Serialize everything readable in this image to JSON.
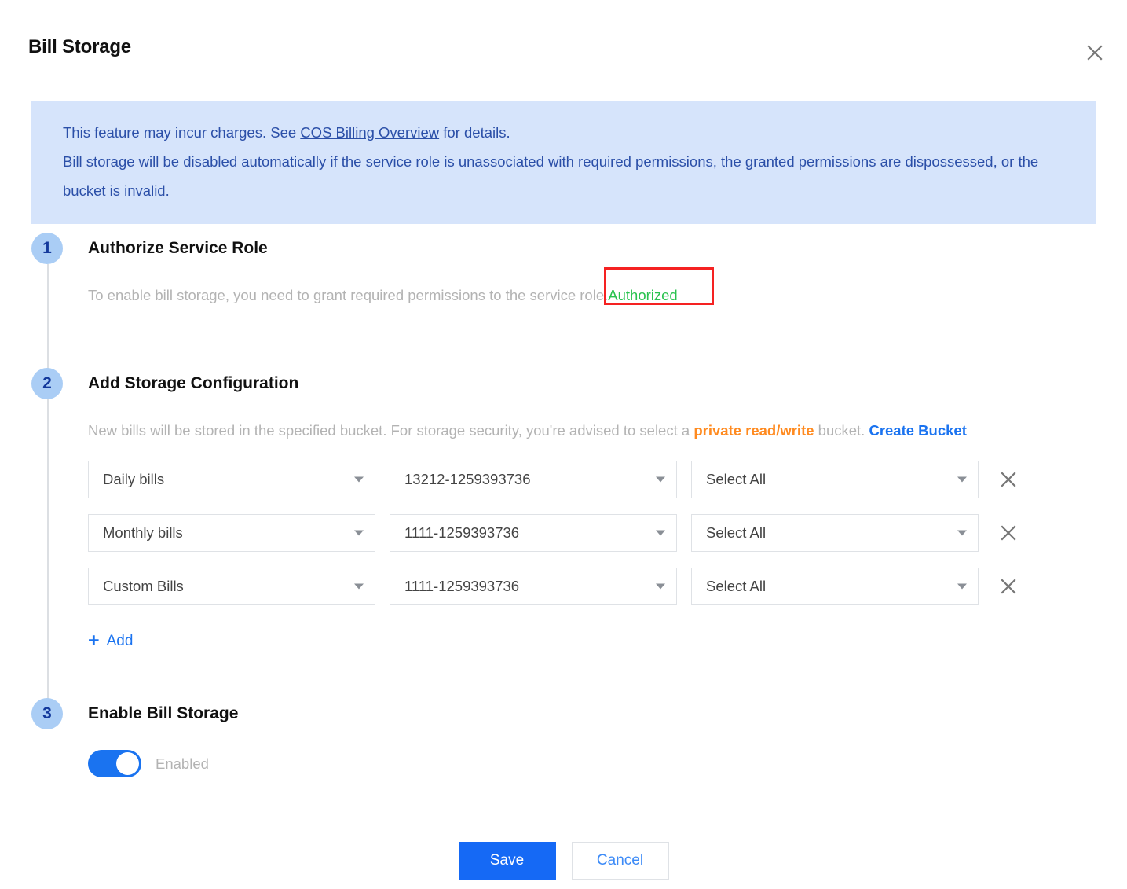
{
  "dialog": {
    "title": "Bill Storage",
    "close_icon": "close-icon"
  },
  "banner": {
    "line1_before": "This feature may incur charges. See ",
    "line1_link": "COS Billing Overview",
    "line1_after": " for details.",
    "line2": "Bill storage will be disabled automatically if the service role is unassociated with required permissions, the granted permissions are dispossessed, or the bucket is invalid.",
    "background_color": "#d6e4fb",
    "text_color": "#2b4fa8"
  },
  "steps": [
    {
      "number": "1",
      "title": "Authorize Service Role",
      "description": "To enable bill storage, you need to grant required permissions to the service role.",
      "status_label": "Authorized",
      "status_color": "#29c24e",
      "annotation_color": "#f52222"
    },
    {
      "number": "2",
      "title": "Add Storage Configuration",
      "desc_part1": "New bills will be stored in the specified bucket. For storage security, you're advised to select a ",
      "desc_highlight": "private read/write",
      "desc_part2": " bucket. ",
      "desc_link": "Create Bucket",
      "highlight_color": "#ff8a1f",
      "link_color": "#1a73f0",
      "add_label": "Add",
      "add_icon": "plus-icon",
      "rows": [
        {
          "bill_type": "Daily bills",
          "bucket": "13212-1259393736",
          "scope": "Select All",
          "delete_icon": "close-icon"
        },
        {
          "bill_type": "Monthly bills",
          "bucket": "1111-1259393736",
          "scope": "Select All",
          "delete_icon": "close-icon"
        },
        {
          "bill_type": "Custom Bills",
          "bucket": "1111-1259393736",
          "scope": "Select All",
          "delete_icon": "close-icon"
        }
      ]
    },
    {
      "number": "3",
      "title": "Enable Bill Storage",
      "toggle_state": "on",
      "toggle_label": "Enabled",
      "toggle_color": "#1a73f0"
    }
  ],
  "footer": {
    "save_label": "Save",
    "cancel_label": "Cancel",
    "save_color": "#1569f5",
    "cancel_text_color": "#3d8bf7"
  }
}
